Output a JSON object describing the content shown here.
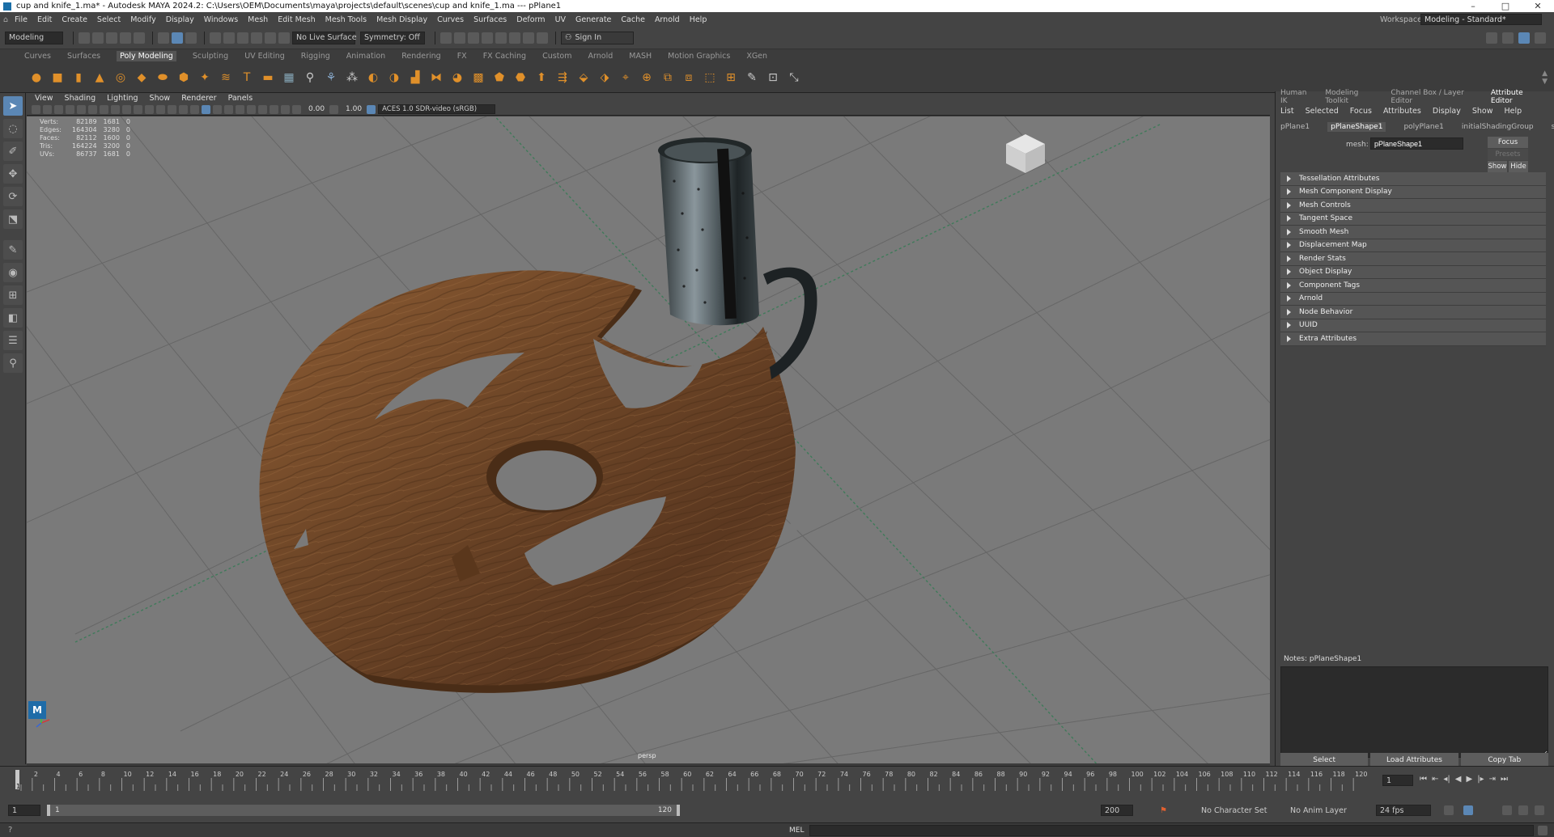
{
  "titlebar": {
    "title": "cup and knife_1.ma* - Autodesk MAYA 2024.2: C:\\Users\\OEM\\Documents\\maya\\projects\\default\\scenes\\cup and knife_1.ma   ---   pPlane1",
    "minimize": "–",
    "maximize": "□",
    "close": "✕"
  },
  "menubar": {
    "items": [
      "File",
      "Edit",
      "Create",
      "Select",
      "Modify",
      "Display",
      "Windows",
      "Mesh",
      "Edit Mesh",
      "Mesh Tools",
      "Mesh Display",
      "Curves",
      "Surfaces",
      "Deform",
      "UV",
      "Generate",
      "Cache",
      "Arnold",
      "Help"
    ],
    "workspace_label": "Workspace:",
    "workspace_value": "Modeling - Standard*"
  },
  "statusline": {
    "mode": "Modeling",
    "live_surface": "No Live Surface",
    "symmetry": "Symmetry: Off",
    "sign_in": "Sign In"
  },
  "shelf": {
    "tabs": [
      "Curves",
      "Surfaces",
      "Poly Modeling",
      "Sculpting",
      "UV Editing",
      "Rigging",
      "Animation",
      "Rendering",
      "FX",
      "FX Caching",
      "Custom",
      "Arnold",
      "MASH",
      "Motion Graphics",
      "XGen"
    ],
    "active_tab": "Poly Modeling"
  },
  "viewport": {
    "menu": [
      "View",
      "Shading",
      "Lighting",
      "Show",
      "Renderer",
      "Panels"
    ],
    "exposure": "0.00",
    "gamma": "1.00",
    "color_space": "ACES 1.0 SDR-video (sRGB)",
    "camera_label": "persp",
    "hud": [
      {
        "label": "Verts:",
        "a": "82189",
        "b": "1681",
        "c": "0"
      },
      {
        "label": "Edges:",
        "a": "164304",
        "b": "3280",
        "c": "0"
      },
      {
        "label": "Faces:",
        "a": "82112",
        "b": "1600",
        "c": "0"
      },
      {
        "label": "Tris:",
        "a": "164224",
        "b": "3200",
        "c": "0"
      },
      {
        "label": "UVs:",
        "a": "86737",
        "b": "1681",
        "c": "0"
      }
    ]
  },
  "attribute_editor": {
    "panel_tabs": [
      "Human IK",
      "Modeling Toolkit",
      "Channel Box / Layer Editor",
      "Attribute Editor"
    ],
    "active_panel_tab": "Attribute Editor",
    "menu": [
      "List",
      "Selected",
      "Focus",
      "Attributes",
      "Display",
      "Show",
      "Help"
    ],
    "node_tabs": [
      "pPlane1",
      "pPlaneShape1",
      "polyPlane1",
      "initialShadingGroup",
      "standa"
    ],
    "active_node_tab": "pPlaneShape1",
    "mesh_label": "mesh:",
    "mesh_value": "pPlaneShape1",
    "focus_button": "Focus",
    "presets_button": "Presets",
    "show_button": "Show",
    "hide_button": "Hide",
    "sections": [
      "Tessellation Attributes",
      "Mesh Component Display",
      "Mesh Controls",
      "Tangent Space",
      "Smooth Mesh",
      "Displacement Map",
      "Render Stats",
      "Object Display",
      "Component Tags",
      "Arnold",
      "Node Behavior",
      "UUID",
      "Extra Attributes"
    ],
    "notes_label": "Notes:  pPlaneShape1",
    "bottom_buttons": [
      "Select",
      "Load Attributes",
      "Copy Tab"
    ]
  },
  "timeline": {
    "ticks": [
      "2",
      "4",
      "6",
      "8",
      "10",
      "12",
      "14",
      "16",
      "18",
      "20",
      "22",
      "24",
      "26",
      "28",
      "30",
      "32",
      "34",
      "36",
      "38",
      "40",
      "42",
      "44",
      "46",
      "48",
      "50",
      "52",
      "54",
      "56",
      "58",
      "60",
      "62",
      "64",
      "66",
      "68",
      "70",
      "72",
      "74",
      "76",
      "78",
      "80",
      "82",
      "84",
      "86",
      "88",
      "90",
      "92",
      "94",
      "96",
      "98",
      "100",
      "102",
      "104",
      "106",
      "108",
      "110",
      "112",
      "114",
      "116",
      "118",
      "120"
    ],
    "current_frame_marker": "1",
    "current_frame_field": "1"
  },
  "range": {
    "start": "1",
    "inner_start": "1",
    "inner_end": "120",
    "end": "200",
    "character_set": "No Character Set",
    "anim_layer": "No Anim Layer",
    "fps": "24 fps"
  },
  "cmdline": {
    "label": "MEL"
  },
  "colors": {
    "accent": "#5b87b5",
    "maya_blue": "#1f6ca8",
    "wood": "#7a4e2c",
    "grid_bg": "#7a7a7a"
  }
}
